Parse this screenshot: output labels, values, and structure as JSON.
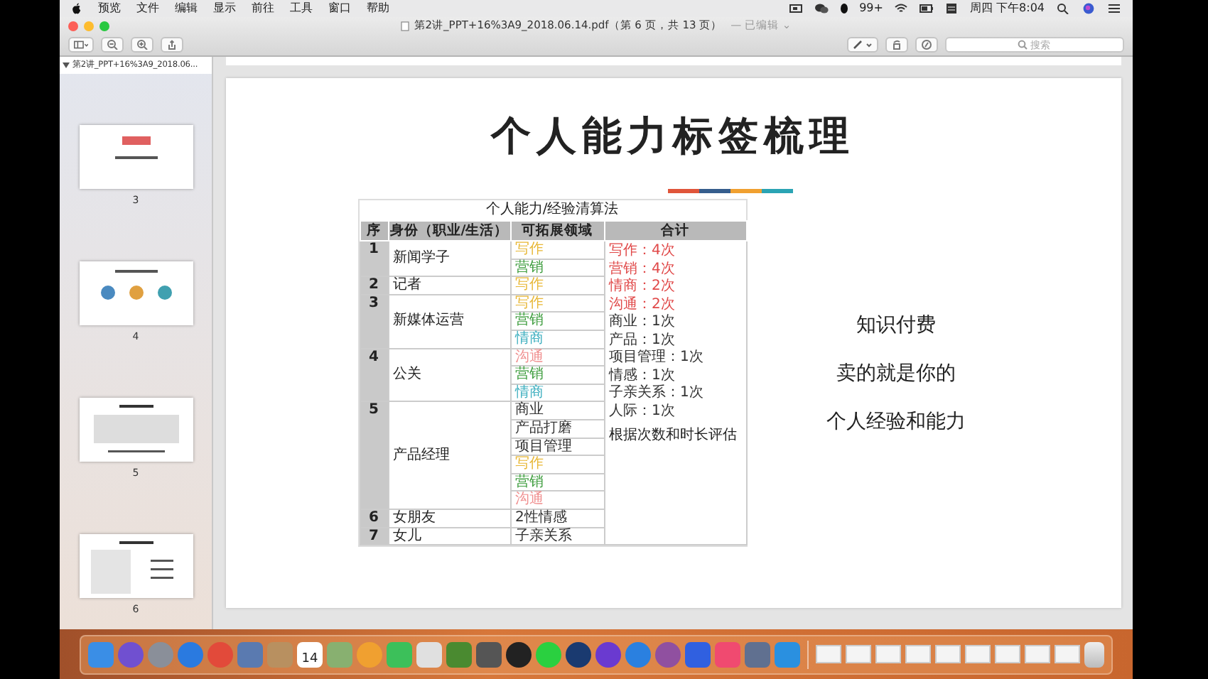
{
  "menubar": {
    "items": [
      "预览",
      "文件",
      "编辑",
      "显示",
      "前往",
      "工具",
      "窗口",
      "帮助"
    ],
    "notification_count": "99+",
    "clock": "周四 下午8:04"
  },
  "window": {
    "title": "第2讲_PPT+16%3A9_2018.06.14.pdf（第 6 页，共 13 页）",
    "status": "— 已编辑 ⌄",
    "search": {
      "placeholder": "搜索"
    }
  },
  "sidebar": {
    "header": "第2讲_PPT+16%3A9_2018.06...",
    "expanded": true,
    "pages": [
      {
        "label": "3"
      },
      {
        "label": "4"
      },
      {
        "label": "5"
      },
      {
        "label": "6"
      }
    ]
  },
  "slide": {
    "title": "个人能力标签梳理",
    "table": {
      "caption": "个人能力/经验清算法",
      "columns": [
        "序",
        "身份（职业/生活）",
        "可拓展领域",
        "合计"
      ],
      "rows": [
        {
          "number": "1",
          "identity": "新闻学子",
          "domains": [
            {
              "text": "写作",
              "color": "#e8b838"
            },
            {
              "text": "营销",
              "color": "#3c9c3c"
            }
          ]
        },
        {
          "number": "2",
          "identity": "记者",
          "domains": [
            {
              "text": "写作",
              "color": "#e8b838"
            }
          ]
        },
        {
          "number": "3",
          "identity": "新媒体运营",
          "domains": [
            {
              "text": "写作",
              "color": "#e8b838"
            },
            {
              "text": "营销",
              "color": "#3c9c3c"
            },
            {
              "text": "情商",
              "color": "#40b0c0"
            }
          ]
        },
        {
          "number": "4",
          "identity": "公关",
          "domains": [
            {
              "text": "沟通",
              "color": "#f09090"
            },
            {
              "text": "营销",
              "color": "#3c9c3c"
            },
            {
              "text": "情商",
              "color": "#40b0c0"
            }
          ]
        },
        {
          "number": "5",
          "identity": "产品经理",
          "domains": [
            {
              "text": "商业",
              "color": "#333333"
            },
            {
              "text": "产品打磨",
              "color": "#333333"
            },
            {
              "text": "项目管理",
              "color": "#333333"
            },
            {
              "text": "写作",
              "color": "#e8b838"
            },
            {
              "text": "营销",
              "color": "#3c9c3c"
            },
            {
              "text": "沟通",
              "color": "#f09090"
            }
          ]
        },
        {
          "number": "6",
          "identity": "女朋友",
          "domains": [
            {
              "text": "2性情感",
              "color": "#333333"
            }
          ]
        },
        {
          "number": "7",
          "identity": "女儿",
          "domains": [
            {
              "text": "子亲关系",
              "color": "#333333"
            }
          ]
        }
      ],
      "totals": [
        {
          "text": "写作：4次",
          "color": "#e04848"
        },
        {
          "text": "营销：4次",
          "color": "#e04848"
        },
        {
          "text": "情商：2次",
          "color": "#e04848"
        },
        {
          "text": "沟通：2次",
          "color": "#e04848"
        },
        {
          "text": "商业：1次",
          "color": "#333333"
        },
        {
          "text": "产品：1次",
          "color": "#333333"
        },
        {
          "text": "项目管理：1次",
          "color": "#333333"
        },
        {
          "text": "情感：1次",
          "color": "#333333"
        },
        {
          "text": "子亲关系：1次",
          "color": "#333333"
        },
        {
          "text": "人际：1次",
          "color": "#333333"
        }
      ],
      "note": "根据次数和时长评估"
    },
    "side_text": [
      "知识付费",
      "卖的就是你的",
      "个人经验和能力"
    ]
  },
  "dock": {
    "calendar_day": "14"
  }
}
